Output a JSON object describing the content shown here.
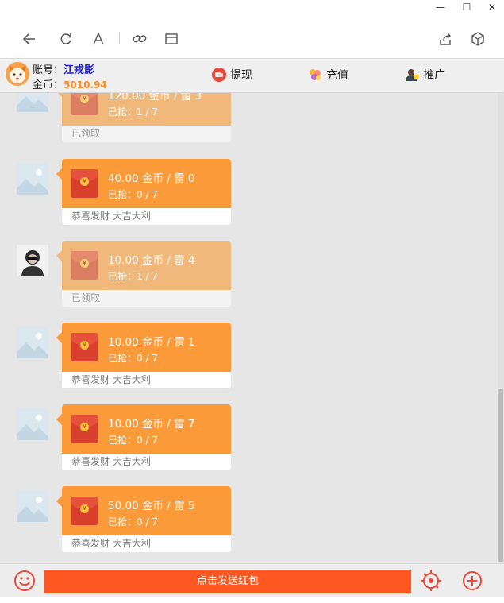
{
  "window": {
    "controls": [
      "—",
      "☐",
      "✕"
    ]
  },
  "toolbar": {
    "icons": [
      "back-icon",
      "refresh-icon",
      "font-icon",
      "link-icon",
      "window-icon",
      "share-icon",
      "cube-icon"
    ]
  },
  "header": {
    "account_label": "账号：",
    "account_name": "江戎影",
    "coin_label": "金币：",
    "coin_value": "5010.94",
    "buttons": {
      "withdraw": "提现",
      "recharge": "充值",
      "promote": "推广"
    }
  },
  "messages": [
    {
      "amount": "120.00 金币 / 雷 3",
      "grabbed": "已抢：1 / 7",
      "footer": "已领取",
      "claimed": true
    },
    {
      "amount": "40.00 金币 / 雷 0",
      "grabbed": "已抢：0 / 7",
      "footer": "恭喜发财 大吉大利",
      "claimed": false
    },
    {
      "amount": "10.00 金币 / 雷 4",
      "grabbed": "已抢：1 / 7",
      "footer": "已领取",
      "claimed": true
    },
    {
      "amount": "10.00 金币 / 雷 1",
      "grabbed": "已抢：0 / 7",
      "footer": "恭喜发财 大吉大利",
      "claimed": false
    },
    {
      "amount": "10.00 金币 / 雷 7",
      "grabbed": "已抢：0 / 7",
      "footer": "恭喜发财 大吉大利",
      "claimed": false
    },
    {
      "amount": "50.00 金币 / 雷 5",
      "grabbed": "已抢：0 / 7",
      "footer": "恭喜发财 大吉大利",
      "claimed": false
    }
  ],
  "bottom": {
    "send_label": "点击发送红包"
  },
  "colors": {
    "bubble": "#fb9a39",
    "bubble_claimed": "#f0b97b",
    "send_button": "#ff5722",
    "account_name": "#1b1bd8",
    "coin_value": "#ff8a1d"
  }
}
